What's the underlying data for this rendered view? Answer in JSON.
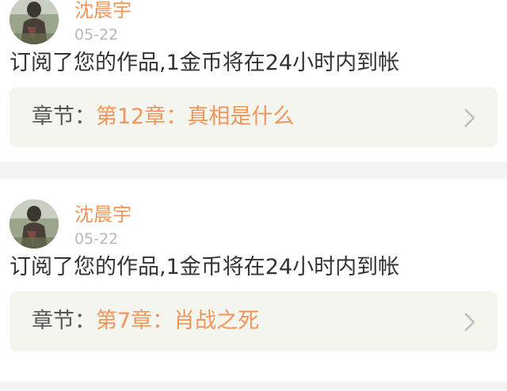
{
  "items": [
    {
      "username": "沈晨宇",
      "date": "05-22",
      "message": "订阅了您的作品,1金币将在24小时内到帐",
      "chapter_prefix": "章节：",
      "chapter_title": "第12章：真相是什么"
    },
    {
      "username": "沈晨宇",
      "date": "05-22",
      "message": "订阅了您的作品,1金币将在24小时内到帐",
      "chapter_prefix": "章节：",
      "chapter_title": "第7章：肖战之死"
    }
  ],
  "colors": {
    "accent": "#f0965a",
    "background": "#f4f4f4",
    "card": "#ffffff",
    "chapter_box": "#f5f5f0",
    "text": "#333333",
    "date": "#b8b8b8"
  },
  "icons": {
    "avatar": "user-avatar-photo",
    "chevron": "chevron-right-icon"
  }
}
